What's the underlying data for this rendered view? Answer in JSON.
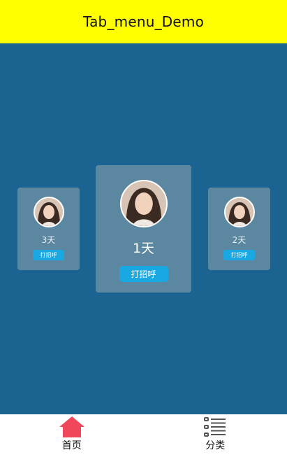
{
  "appbar": {
    "title": "Tab_menu_Demo"
  },
  "cards": [
    {
      "position": "left",
      "days": "3天",
      "button_label": "打招呼"
    },
    {
      "position": "center",
      "days": "1天",
      "button_label": "打招呼"
    },
    {
      "position": "right",
      "days": "2天",
      "button_label": "打招呼"
    }
  ],
  "bottom_nav": {
    "items": [
      {
        "label": "首页",
        "icon": "home-icon",
        "active": true,
        "color": "#f0475a"
      },
      {
        "label": "分类",
        "icon": "list-icon",
        "active": false,
        "color": "#555555"
      }
    ]
  },
  "colors": {
    "appbar": "#ffff00",
    "background": "#1b6390",
    "card": "#5c87a1",
    "button": "#1aa8e3"
  }
}
